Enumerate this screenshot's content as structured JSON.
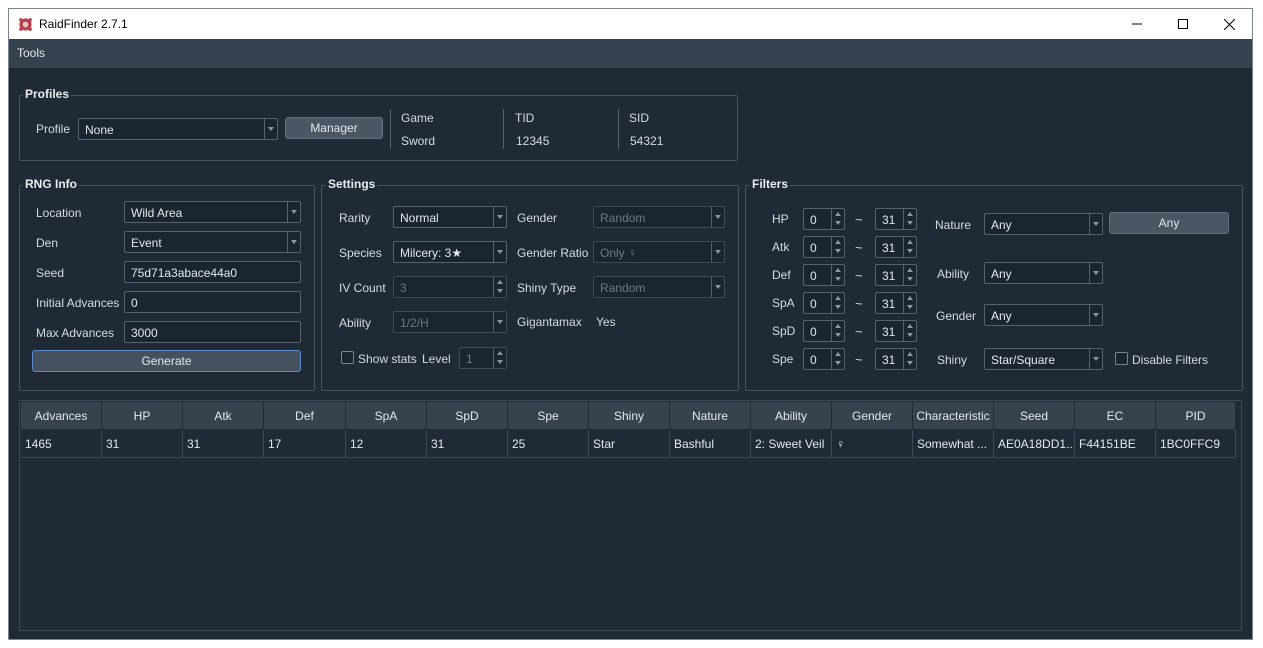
{
  "window": {
    "title": "RaidFinder 2.7.1"
  },
  "menu": {
    "tools": "Tools"
  },
  "profiles": {
    "title": "Profiles",
    "profile_label": "Profile",
    "profile_value": "None",
    "manager_label": "Manager",
    "game_label": "Game",
    "game_value": "Sword",
    "tid_label": "TID",
    "tid_value": "12345",
    "sid_label": "SID",
    "sid_value": "54321"
  },
  "rng": {
    "title": "RNG Info",
    "location_label": "Location",
    "location_value": "Wild Area",
    "den_label": "Den",
    "den_value": "Event",
    "seed_label": "Seed",
    "seed_value": "75d71a3abace44a0",
    "initial_label": "Initial Advances",
    "initial_value": "0",
    "max_label": "Max Advances",
    "max_value": "3000",
    "generate_label": "Generate"
  },
  "settings": {
    "title": "Settings",
    "rarity_label": "Rarity",
    "rarity_value": "Normal",
    "species_label": "Species",
    "species_value": "Milcery: 3★",
    "ivcount_label": "IV Count",
    "ivcount_value": "3",
    "ability_label": "Ability",
    "ability_value": "1/2/H",
    "gender_label": "Gender",
    "gender_value": "Random",
    "ratio_label": "Gender Ratio",
    "ratio_value": "Only ♀",
    "shinytype_label": "Shiny Type",
    "shinytype_value": "Random",
    "gmax_label": "Gigantamax",
    "gmax_value": "Yes",
    "showstats_label": "Show stats",
    "level_label": "Level",
    "level_value": "1"
  },
  "filters": {
    "title": "Filters",
    "tilde": "~",
    "ivs": [
      {
        "label": "HP",
        "min": "0",
        "max": "31"
      },
      {
        "label": "Atk",
        "min": "0",
        "max": "31"
      },
      {
        "label": "Def",
        "min": "0",
        "max": "31"
      },
      {
        "label": "SpA",
        "min": "0",
        "max": "31"
      },
      {
        "label": "SpD",
        "min": "0",
        "max": "31"
      },
      {
        "label": "Spe",
        "min": "0",
        "max": "31"
      }
    ],
    "nature_label": "Nature",
    "nature_value": "Any",
    "any_button": "Any",
    "ability_label": "Ability",
    "ability_value": "Any",
    "gender_label": "Gender",
    "gender_value": "Any",
    "shiny_label": "Shiny",
    "shiny_value": "Star/Square",
    "disable_label": "Disable Filters"
  },
  "table": {
    "columns": [
      "Advances",
      "HP",
      "Atk",
      "Def",
      "SpA",
      "SpD",
      "Spe",
      "Shiny",
      "Nature",
      "Ability",
      "Gender",
      "Characteristic",
      "Seed",
      "EC",
      "PID"
    ],
    "rows": [
      [
        "1465",
        "31",
        "31",
        "17",
        "12",
        "31",
        "25",
        "Star",
        "Bashful",
        "2: Sweet Veil",
        "♀",
        "Somewhat ...",
        "AE0A18DD1...",
        "F44151BE",
        "1BC0FFC9"
      ]
    ]
  }
}
